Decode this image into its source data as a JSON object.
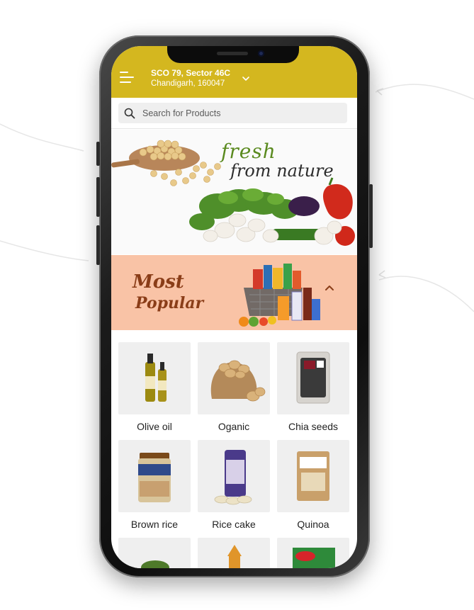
{
  "header": {
    "address_line1": "SCO 79, Sector 46C",
    "address_line2": "Chandigarh, 160047"
  },
  "search": {
    "placeholder": "Search for Products"
  },
  "banner": {
    "headline_1": "fresh",
    "headline_2": "from nature"
  },
  "popular": {
    "title_word_1": "Most",
    "title_word_2": "Popular"
  },
  "products": [
    {
      "label": "Olive oil"
    },
    {
      "label": "Oganic"
    },
    {
      "label": "Chia seeds"
    },
    {
      "label": "Brown rice"
    },
    {
      "label": "Rice cake"
    },
    {
      "label": "Quinoa"
    }
  ],
  "colors": {
    "header": "#d4b71f",
    "popular_bg": "#f9c3a6",
    "popular_text": "#8a3d18",
    "tile_bg": "#efefef"
  }
}
